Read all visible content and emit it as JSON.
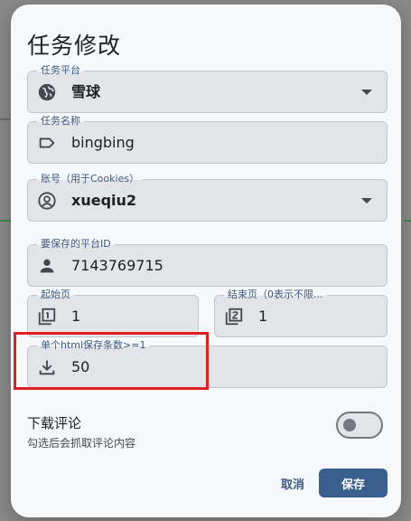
{
  "dialog": {
    "title": "任务修改"
  },
  "fields": {
    "platform": {
      "label": "任务平台",
      "value": "雪球",
      "icon": "globe-icon"
    },
    "task_name": {
      "label": "任务名称",
      "value": "bingbing",
      "icon": "label-tag-icon"
    },
    "account": {
      "label": "账号（用于Cookies）",
      "value": "xueqiu2",
      "icon": "account-circle-icon"
    },
    "platform_id": {
      "label": "要保存的平台ID",
      "value": "7143769715",
      "icon": "person-icon"
    },
    "start_page": {
      "label": "起始页",
      "value": "1",
      "icon": "filter-1-icon"
    },
    "end_page": {
      "label": "结束页（0表示不限...",
      "value": "1",
      "icon": "filter-2-icon"
    },
    "per_html": {
      "label": "单个html保存条数>=1",
      "value": "50",
      "icon": "download-icon"
    }
  },
  "comments_toggle": {
    "title": "下载评论",
    "subtitle": "勾选后会抓取评论内容",
    "checked": false
  },
  "actions": {
    "cancel": "取消",
    "save": "保存"
  },
  "colors": {
    "accent": "#3a5f8c",
    "label": "#3d5a80",
    "highlight_border": "#e02020"
  }
}
